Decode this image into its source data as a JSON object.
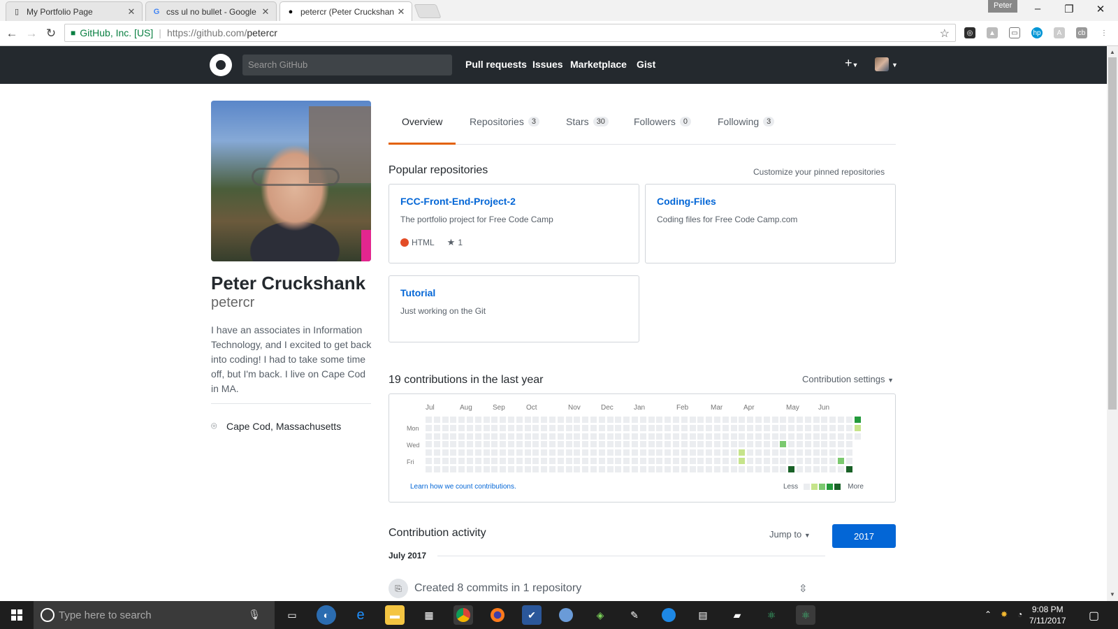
{
  "browser": {
    "tabs": [
      {
        "title": "My Portfolio Page",
        "icon": "page-icon"
      },
      {
        "title": "css ul no bullet - Google",
        "icon": "google-icon"
      },
      {
        "title": "petercr (Peter Cruckshan",
        "icon": "github-icon"
      }
    ],
    "profile_user": "Peter",
    "secure_label": "GitHub, Inc. [US]",
    "url_scheme_host": "https://github.com/",
    "url_path": "petercr"
  },
  "gh": {
    "search_placeholder": "Search GitHub",
    "nav": [
      "Pull requests",
      "Issues",
      "Marketplace",
      "Gist"
    ]
  },
  "profile": {
    "name": "Peter Cruckshank",
    "username": "petercr",
    "bio": "I have an associates in Information Technology, and I excited to get back into coding! I had to take some time off, but I'm back. I live on Cape Cod in MA.",
    "location": "Cape Cod, Massachusetts"
  },
  "tabs": [
    {
      "label": "Overview",
      "count": null
    },
    {
      "label": "Repositories",
      "count": "3"
    },
    {
      "label": "Stars",
      "count": "30"
    },
    {
      "label": "Followers",
      "count": "0"
    },
    {
      "label": "Following",
      "count": "3"
    }
  ],
  "popular": {
    "title": "Popular repositories",
    "customize": "Customize your pinned repositories",
    "repos": [
      {
        "name": "FCC-Front-End-Project-2",
        "desc": "The portfolio project for Free Code Camp",
        "lang": "HTML",
        "lang_color": "#e34c26",
        "stars": "1"
      },
      {
        "name": "Coding-Files",
        "desc": "Coding files for Free Code Camp.com"
      },
      {
        "name": "Tutorial",
        "desc": "Just working on the Git"
      }
    ]
  },
  "contrib": {
    "title": "19 contributions in the last year",
    "settings": "Contribution settings",
    "months": [
      "Jul",
      "Aug",
      "Sep",
      "Oct",
      "Nov",
      "Dec",
      "Jan",
      "Feb",
      "Mar",
      "Apr",
      "May",
      "Jun"
    ],
    "weekdays": [
      "Mon",
      "Wed",
      "Fri"
    ],
    "learn": "Learn how we count contributions.",
    "less": "Less",
    "more": "More",
    "colors": [
      "#ebedf0",
      "#c6e48b",
      "#7bc96f",
      "#239a3b",
      "#196127"
    ]
  },
  "activity": {
    "title": "Contribution activity",
    "jump": "Jump to",
    "year": "2017",
    "month": "July 2017",
    "item": "Created 8 commits in 1 repository"
  },
  "taskbar": {
    "search": "Type here to search",
    "time": "9:08 PM",
    "date": "7/11/2017"
  }
}
